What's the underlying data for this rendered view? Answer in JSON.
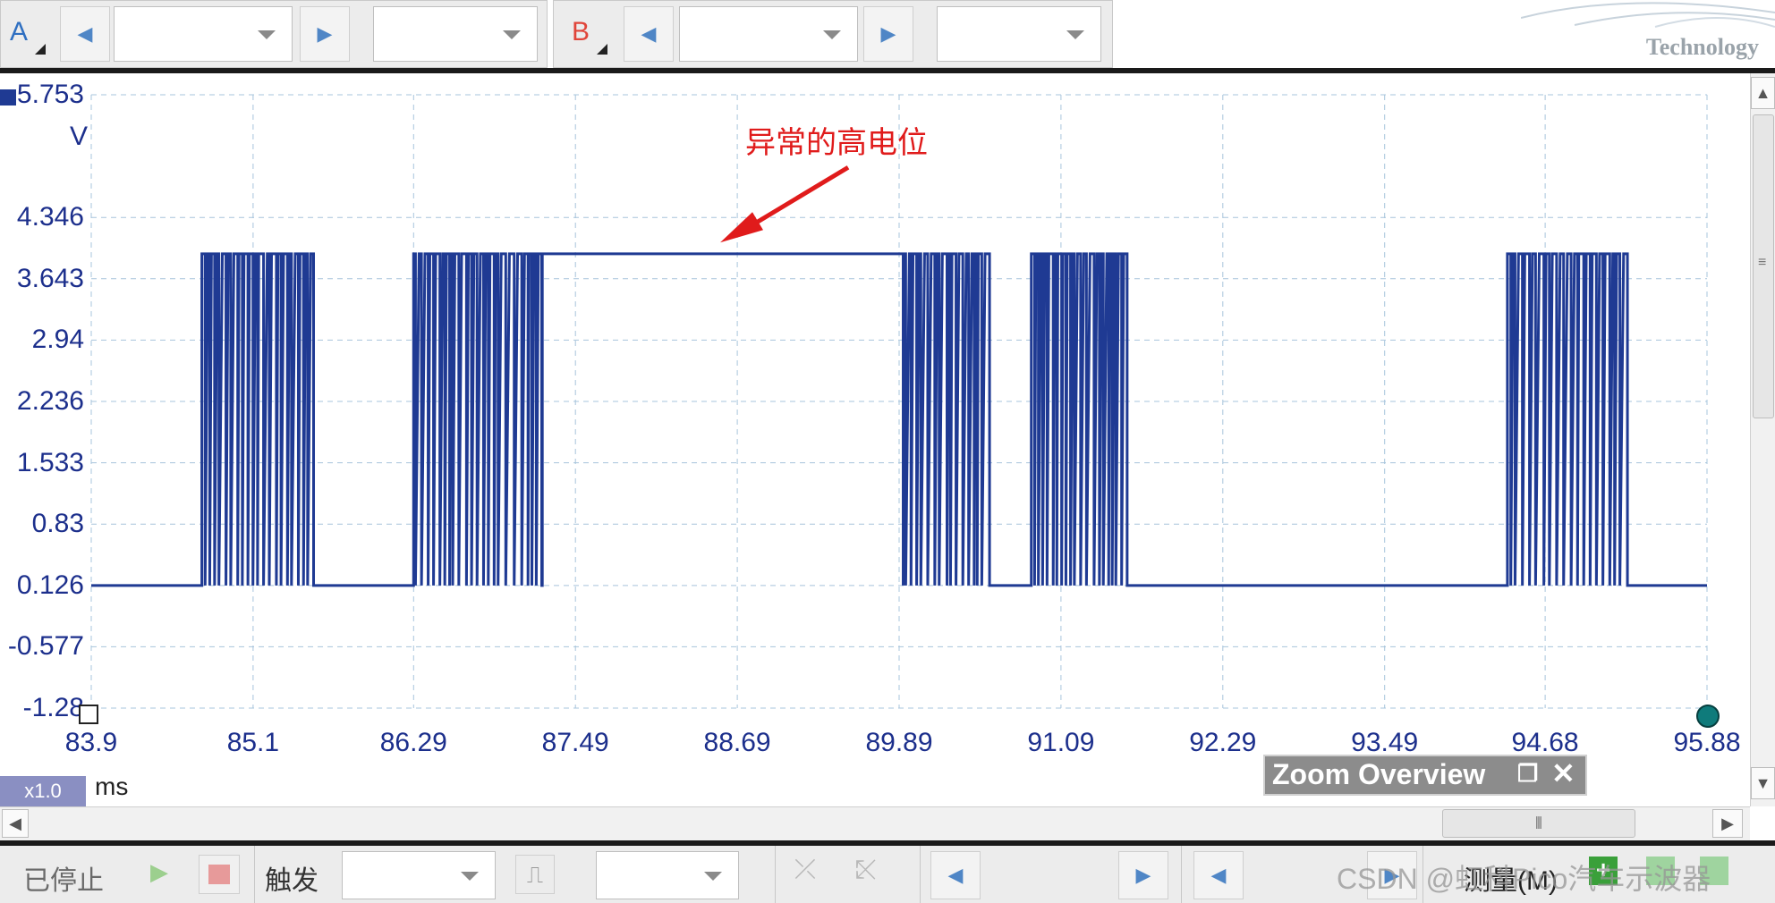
{
  "toolbar": {
    "channel_a": {
      "label": "A",
      "color": "#2f6fc1"
    },
    "channel_b": {
      "label": "B",
      "color": "#e0453a"
    },
    "logo_text": "Technology"
  },
  "chart_data": {
    "type": "line",
    "series": [
      {
        "values_note": "",
        "color": "#1f3a93"
      }
    ],
    "y_ticks": [
      "5.753",
      "4.346",
      "3.643",
      "2.94",
      "2.236",
      "1.533",
      "0.83",
      "0.126",
      "-0.577",
      "-1.28"
    ],
    "y_unit": "V",
    "x_ticks": [
      "83.9",
      "85.1",
      "86.29",
      "87.49",
      "88.69",
      "89.89",
      "91.09",
      "92.29",
      "93.49",
      "94.68",
      "95.88"
    ],
    "x_unit": "ms",
    "ylim": [
      -1.28,
      5.753
    ],
    "xlim": [
      83.9,
      95.88
    ],
    "low_level": 0.126,
    "high_level": 3.93,
    "bursts": [
      [
        84.72,
        85.55
      ],
      [
        86.29,
        87.24
      ],
      [
        89.92,
        90.55
      ],
      [
        90.87,
        91.6
      ],
      [
        94.4,
        95.3
      ]
    ],
    "plateau": [
      87.24,
      89.92
    ],
    "grid": true,
    "annotation": {
      "text": "异常的高电位",
      "x": 88.55,
      "y": 4.1,
      "color": "#e01b1b"
    }
  },
  "plot": {
    "zoom_overview": "Zoom Overview",
    "zoom_factor": "x1.0",
    "unit": "ms"
  },
  "bottom": {
    "status": "已停止",
    "trigger": "触发",
    "measure": "测量(M)",
    "watermark": "CSDN @虹科Pico汽车示波器"
  }
}
